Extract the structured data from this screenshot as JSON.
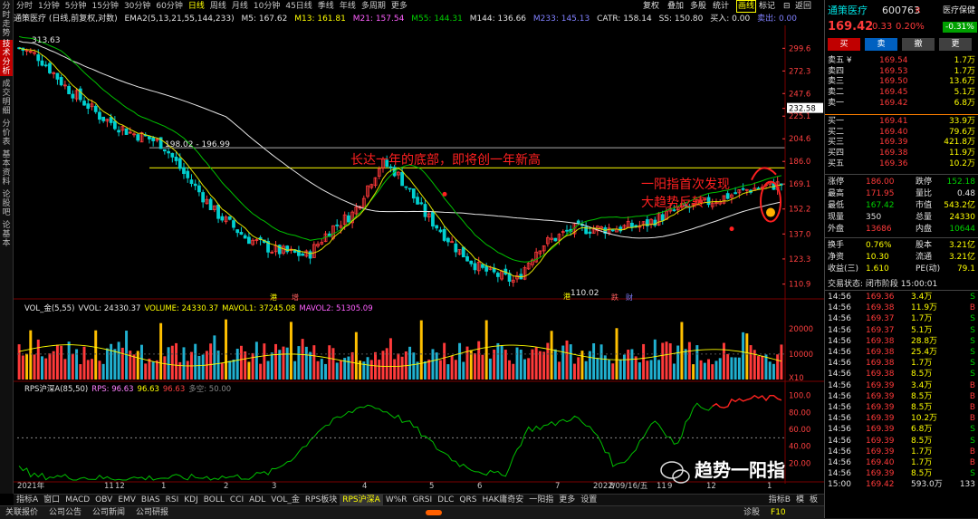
{
  "left_tabs": [
    "分时走势",
    "技术分析",
    "成交明细",
    "分价表",
    "基本资料",
    "论股吧",
    "论基本"
  ],
  "periods": [
    "分时",
    "1分钟",
    "5分钟",
    "15分钟",
    "30分钟",
    "60分钟",
    "日线",
    "周线",
    "月线",
    "10分钟",
    "45日线",
    "季线",
    "年线",
    "多周期",
    "更多"
  ],
  "tools": {
    "restore": "复权",
    "add": "叠加",
    "multi": "多股",
    "stats": "统计",
    "draw": "画线",
    "mark": "标记",
    "back": "返回"
  },
  "info": {
    "title": "通策医疗 (日线,前复权,对数)",
    "ema": "EMA2(5,13,21,55,144,233)",
    "m5": "M5: 167.62",
    "m13": "M13: 161.81",
    "m21": "M21: 157.54",
    "m55": "M55: 144.31",
    "m144": "M144: 136.66",
    "m233": "M233: 145.13",
    "catr": "CATR: 158.14",
    "ss": "SS: 150.80",
    "buy": "买入: 0.00",
    "sell": "卖出: 0.00"
  },
  "price_axis": [
    "299.6",
    "272.3",
    "247.6",
    "232.58",
    "225.1",
    "204.6",
    "186.0",
    "169.1",
    "152.2",
    "137.0",
    "123.3",
    "110.9"
  ],
  "vol_axis": [
    "20000",
    "10000",
    "X10"
  ],
  "rps_axis": [
    "100.0",
    "80.00",
    "60.00",
    "40.00",
    "20.00"
  ],
  "date_axis": [
    "2021年",
    "11",
    "12",
    "1",
    "2",
    "3",
    "4",
    "5",
    "6",
    "7",
    "8",
    "9",
    "2022/09/16/五",
    "11",
    "12",
    "1"
  ],
  "annotations": {
    "max": "313.63",
    "range": "198.02 - 196.99",
    "min": "110.02",
    "text1": "长达一年的底部，即将创一年新高",
    "text2": "一阳指首次发现",
    "text3": "大趋势反转",
    "tag_harbor": "港",
    "tag_add": "增",
    "tag_fall": "跌",
    "tag_money": "财",
    "tag_h": "港"
  },
  "vol_info": {
    "name": "VOL_金(5,55)",
    "vvol": "VVOL: 24330.37",
    "volume": "VOLUME: 24330.37",
    "mavol1": "MAVOL1: 37245.08",
    "mavol2": "MAVOL2: 51305.09"
  },
  "rps_info": {
    "name": "RPS沪深A(85,50)",
    "rps": "RPS: 96.63",
    "v2": "96.63",
    "v3": "96.63",
    "dk": "多空: 50.00"
  },
  "bottom_tabs": [
    "指标A",
    "窗口",
    "MACD",
    "OBV",
    "EMV",
    "BIAS",
    "RSI",
    "KDJ",
    "BOLL",
    "CCI",
    "ADL",
    "VOL_金",
    "RPS板块",
    "RPS沪深A",
    "W%R",
    "GRSI",
    "DLC",
    "QRS",
    "HAK庸奇安",
    "一阳指",
    "更多",
    "设置"
  ],
  "bottom_right": [
    "指标B",
    "模",
    "板"
  ],
  "status": [
    "关联报价",
    "公司公告",
    "公司新闻",
    "公司研报"
  ],
  "status_right": [
    "诊股",
    "F10"
  ],
  "stock": {
    "name": "通策医疗",
    "code": "600763",
    "flag": "R",
    "tag": "医疗保健",
    "tag_pct": "-0.31%",
    "price": "169.42",
    "chg": "0.33",
    "pct": "0.20%",
    "btn_buy": "买",
    "btn_sell": "卖",
    "btn_cancel": "撤",
    "btn_more": "更"
  },
  "sell_book": [
    [
      "卖五 ¥",
      "169.54",
      "1.7万"
    ],
    [
      "卖四",
      "169.53",
      "1.7万"
    ],
    [
      "卖三",
      "169.50",
      "13.6万"
    ],
    [
      "卖二",
      "169.45",
      "5.1万"
    ],
    [
      "卖一",
      "169.42",
      "6.8万"
    ]
  ],
  "buy_book": [
    [
      "买一",
      "169.41",
      "33.9万"
    ],
    [
      "买二",
      "169.40",
      "79.6万"
    ],
    [
      "买三",
      "169.39",
      "421.8万"
    ],
    [
      "买四",
      "169.38",
      "11.9万"
    ],
    [
      "买五",
      "169.36",
      "10.2万"
    ]
  ],
  "stats1": [
    [
      "涨停",
      "186.00",
      "跌停",
      "152.18"
    ],
    [
      "最高",
      "171.95",
      "量比",
      "0.48"
    ],
    [
      "最低",
      "167.42",
      "市值",
      "543.2亿"
    ],
    [
      "现量",
      "350",
      "总量",
      "24330"
    ],
    [
      "外盘",
      "13686",
      "内盘",
      "10644"
    ]
  ],
  "stats2": [
    [
      "换手",
      "0.76%",
      "股本",
      "3.21亿"
    ],
    [
      "净资",
      "10.30",
      "流通",
      "3.21亿"
    ],
    [
      "收益(三)",
      "1.610",
      "PE(动)",
      "79.1"
    ]
  ],
  "trade_state": "交易状态: 闭市阶段 15:00:01",
  "ticks": [
    [
      "14:56",
      "169.36",
      "3.4万",
      "S"
    ],
    [
      "14:56",
      "169.38",
      "11.9万",
      "B"
    ],
    [
      "14:56",
      "169.37",
      "1.7万",
      "S"
    ],
    [
      "14:56",
      "169.37",
      "5.1万",
      "S"
    ],
    [
      "14:56",
      "169.38",
      "28.8万",
      "S"
    ],
    [
      "14:56",
      "169.38",
      "25.4万",
      "S"
    ],
    [
      "14:56",
      "169.38",
      "1.7万",
      "S"
    ],
    [
      "14:56",
      "169.38",
      "8.5万",
      "S"
    ],
    [
      "14:56",
      "169.39",
      "3.4万",
      "B"
    ],
    [
      "14:56",
      "169.39",
      "8.5万",
      "B"
    ],
    [
      "14:56",
      "169.39",
      "8.5万",
      "B"
    ],
    [
      "14:56",
      "169.39",
      "10.2万",
      "B"
    ],
    [
      "14:56",
      "169.39",
      "6.8万",
      "S"
    ],
    [
      "14:56",
      "169.39",
      "8.5万",
      "S"
    ],
    [
      "14:56",
      "169.39",
      "1.7万",
      "B"
    ],
    [
      "14:56",
      "169.40",
      "1.7万",
      "B"
    ],
    [
      "14:56",
      "169.39",
      "8.5万",
      "S"
    ],
    [
      "15:00",
      "169.42",
      "593.0万",
      "133"
    ]
  ],
  "watermark": "趋势一阳指",
  "colors": {
    "up": "#ff3a3a",
    "down": "#00d0d0",
    "price_white": "#e6e6e6",
    "yellow": "#ffff00",
    "green": "#00c000",
    "pink": "#ff80ff",
    "annot_red": "#ff2020"
  }
}
